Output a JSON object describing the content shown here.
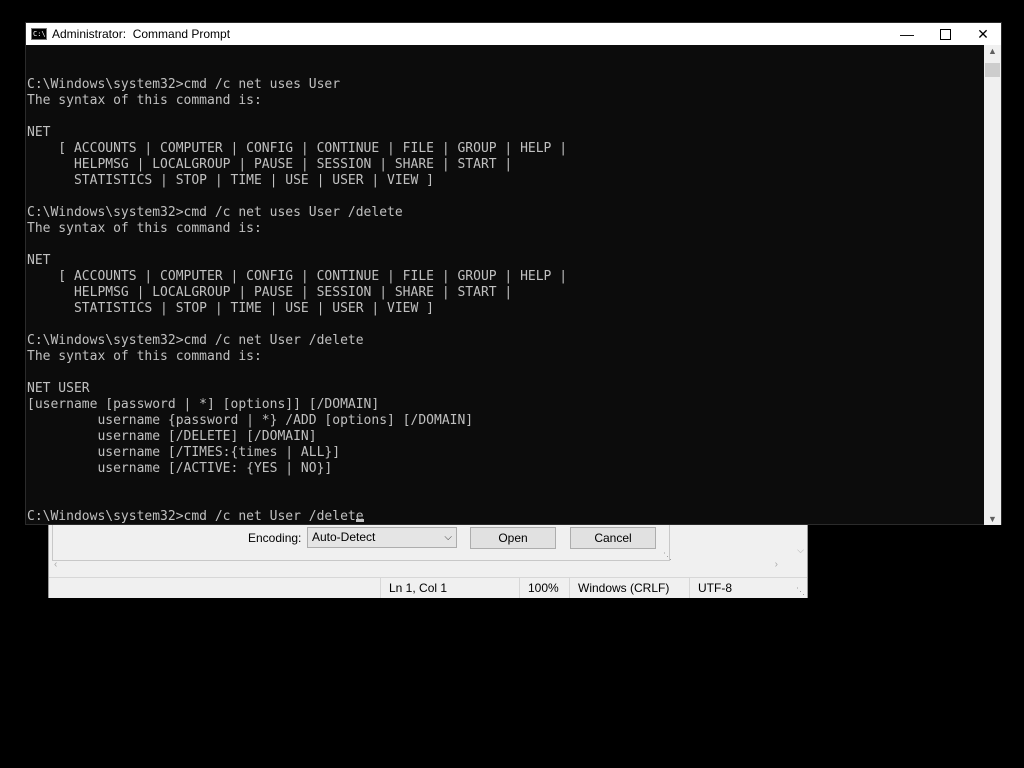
{
  "notepad": {
    "encoding_label": "Encoding:",
    "encoding_value": "Auto-Detect",
    "open_button": "Open",
    "cancel_button": "Cancel",
    "status": {
      "position": "Ln 1, Col 1",
      "zoom": "100%",
      "line_endings": "Windows (CRLF)",
      "encoding": "UTF-8"
    }
  },
  "cmd": {
    "title": "Administrator:  Command Prompt",
    "lines": [
      "C:\\Windows\\system32>cmd /c net uses User",
      "The syntax of this command is:",
      "",
      "NET",
      "    [ ACCOUNTS | COMPUTER | CONFIG | CONTINUE | FILE | GROUP | HELP |",
      "      HELPMSG | LOCALGROUP | PAUSE | SESSION | SHARE | START |",
      "      STATISTICS | STOP | TIME | USE | USER | VIEW ]",
      "",
      "C:\\Windows\\system32>cmd /c net uses User /delete",
      "The syntax of this command is:",
      "",
      "NET",
      "    [ ACCOUNTS | COMPUTER | CONFIG | CONTINUE | FILE | GROUP | HELP |",
      "      HELPMSG | LOCALGROUP | PAUSE | SESSION | SHARE | START |",
      "      STATISTICS | STOP | TIME | USE | USER | VIEW ]",
      "",
      "C:\\Windows\\system32>cmd /c net User /delete",
      "The syntax of this command is:",
      "",
      "NET USER",
      "[username [password | *] [options]] [/DOMAIN]",
      "         username {password | *} /ADD [options] [/DOMAIN]",
      "         username [/DELETE] [/DOMAIN]",
      "         username [/TIMES:{times | ALL}]",
      "         username [/ACTIVE: {YES | NO}]",
      "",
      "",
      "C:\\Windows\\system32>cmd /c net User /delete"
    ]
  },
  "icons": {
    "cmd_app": "command-prompt-icon",
    "minimize": "minimize-icon",
    "maximize": "maximize-icon",
    "close": "close-icon",
    "dropdown": "chevron-down-icon"
  },
  "colors": {
    "console_background": "#0c0c0c",
    "console_text": "#c0c0c0",
    "titlebar": "#ffffff",
    "desktop": "#000000"
  }
}
